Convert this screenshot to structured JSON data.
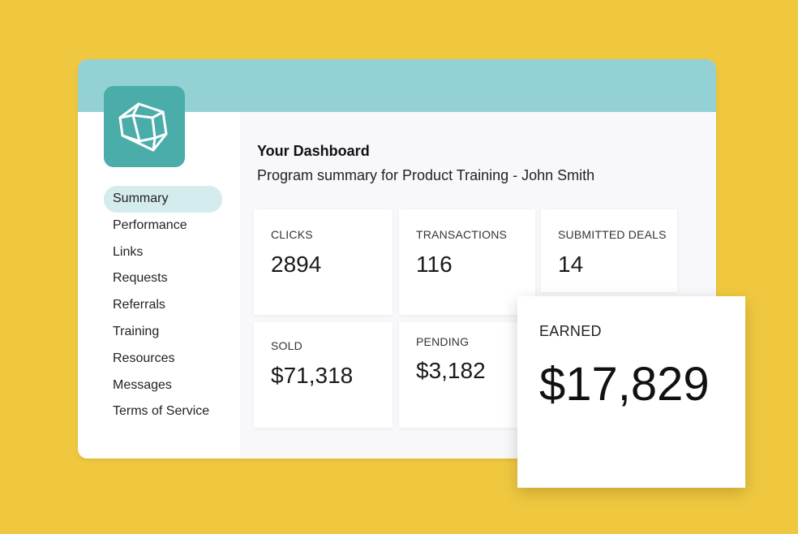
{
  "sidebar": {
    "items": [
      {
        "label": "Summary",
        "active": true
      },
      {
        "label": "Performance"
      },
      {
        "label": "Links"
      },
      {
        "label": "Requests"
      },
      {
        "label": "Referrals"
      },
      {
        "label": "Training"
      },
      {
        "label": "Resources"
      },
      {
        "label": "Messages"
      },
      {
        "label": "Terms of Service"
      }
    ]
  },
  "header": {
    "title": "Your Dashboard",
    "subtitle": "Program summary for Product Training - John Smith"
  },
  "stats": {
    "clicks": {
      "label": "CLICKS",
      "value": "2894"
    },
    "transactions": {
      "label": "TRANSACTIONS",
      "value": "116"
    },
    "submitted_deals": {
      "label": "SUBMITTED DEALS",
      "value": "14"
    },
    "sold": {
      "label": "SOLD",
      "value": "$71,318"
    },
    "pending": {
      "label": "PENDING",
      "value": "$3,182"
    },
    "earned": {
      "label": "EARNED",
      "value": "$17,829"
    }
  },
  "colors": {
    "background": "#F0C83F",
    "topbar": "#93D1D5",
    "logo": "#4AADAA",
    "active_nav": "#D4ECEE"
  },
  "icons": {
    "logo": "cube-icon"
  }
}
